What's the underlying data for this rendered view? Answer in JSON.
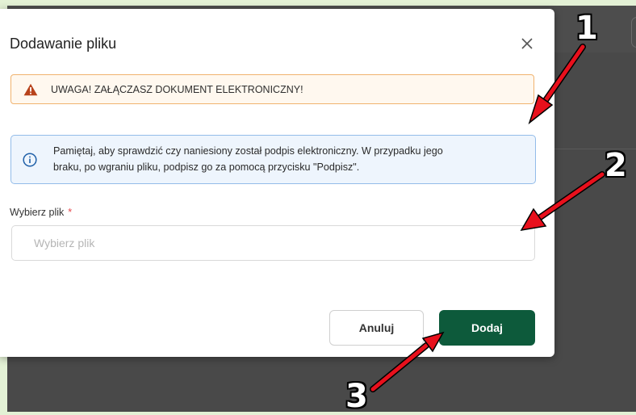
{
  "modal": {
    "title": "Dodawanie pliku",
    "close_icon": "close-icon"
  },
  "warning": {
    "icon": "warning-triangle-icon",
    "text": "UWAGA! ZAŁĄCZASZ DOKUMENT ELEKTRONICZNY!"
  },
  "info": {
    "icon": "info-circle-icon",
    "line1": "Pamiętaj, aby sprawdzić czy naniesiony został podpis elektroniczny. W przypadku jego",
    "line2": "braku, po wgraniu pliku, podpisz go za pomocą przycisku \"Podpisz\"."
  },
  "file_field": {
    "label": "Wybierz plik",
    "required_mark": "*",
    "placeholder": "Wybierz plik"
  },
  "buttons": {
    "cancel": "Anuluj",
    "add": "Dodaj"
  },
  "annotations": {
    "marker_1": "1",
    "marker_2": "2",
    "marker_3": "3",
    "arrow_color": "#e8101c"
  },
  "colors": {
    "primary": "#0d5a3b",
    "warning_border": "#f0b36f",
    "warning_icon": "#b8431c",
    "info_border": "#93bce9",
    "info_icon": "#1e5fa8",
    "required": "#e5484d"
  }
}
